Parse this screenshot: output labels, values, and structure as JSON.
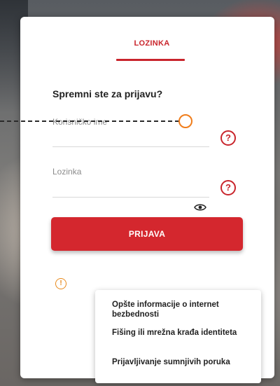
{
  "tabs": {
    "active_label": "LOZINKA"
  },
  "form": {
    "heading": "Spremni ste za prijavu?",
    "username_label": "Korisničko ime",
    "password_label": "Lozinka",
    "help_symbol": "?",
    "submit_label": "PRIJAVA"
  },
  "info": {
    "icon_symbol": "!",
    "links": [
      "Opšte informacije o internet bezbednosti",
      "Fišing ili mrežna krađa identiteta",
      "Prijavljivanje sumnjivih poruka"
    ]
  },
  "colors": {
    "accent": "#d4272e",
    "focus": "#f07d1b",
    "info": "#e8891b"
  }
}
